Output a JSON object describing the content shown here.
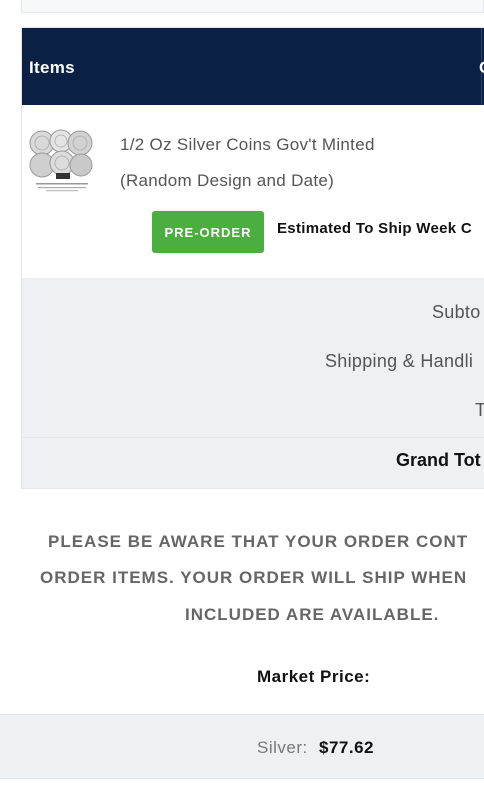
{
  "table": {
    "header_items": "Items",
    "header_next": "C"
  },
  "item": {
    "name_line1": "1/2 Oz Silver Coins Gov't Minted",
    "name_line2": "(Random Design and Date)",
    "badge": "PRE-ORDER",
    "ship_note": "Estimated To Ship Week C",
    "thumbnail_icon": "silver-coins-thumbnail-icon"
  },
  "totals": {
    "subtotal_label": "Subto",
    "shipping_label": "Shipping & Handli",
    "tax_label": "T",
    "grand_total_label": "Grand Tot"
  },
  "notice": {
    "line1": "PLEASE BE AWARE THAT YOUR ORDER CONT",
    "line2": "ORDER ITEMS. YOUR ORDER WILL SHIP WHEN",
    "line3": "INCLUDED ARE AVAILABLE."
  },
  "market": {
    "label": "Market Price:",
    "silver_label": "Silver:",
    "silver_value": "$77.62"
  },
  "colors": {
    "header_bg": "#0a2145",
    "badge_bg": "#4cae3f",
    "totals_bg": "#eef0f4"
  }
}
